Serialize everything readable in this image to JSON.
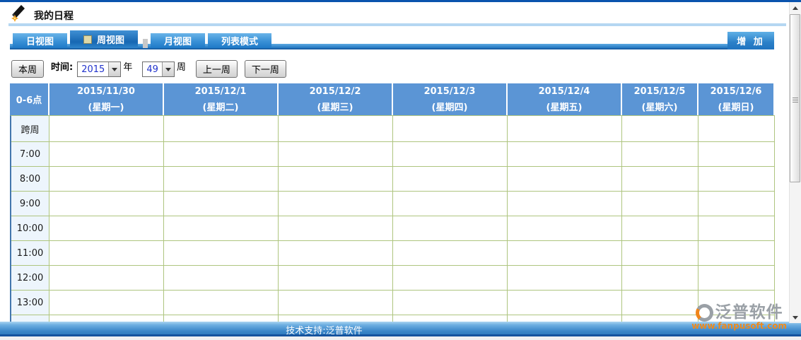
{
  "window": {
    "title": "我的日程"
  },
  "tabs": {
    "items": [
      {
        "label": "日视图",
        "active": false
      },
      {
        "label": "周视图",
        "active": true
      },
      {
        "label": "月视图",
        "active": false
      },
      {
        "label": "列表模式",
        "active": false
      }
    ],
    "add_button": "增 加"
  },
  "controls": {
    "this_week": "本周",
    "time_label": "时间:",
    "year": {
      "value": "2015",
      "suffix": "年"
    },
    "week": {
      "value": "49",
      "suffix": "周"
    },
    "prev_week": "上一周",
    "next_week": "下一周"
  },
  "calendar": {
    "corner": "0-6点",
    "days": [
      {
        "date": "2015/11/30",
        "weekday": "(星期一)"
      },
      {
        "date": "2015/12/1",
        "weekday": "(星期二)"
      },
      {
        "date": "2015/12/2",
        "weekday": "(星期三)"
      },
      {
        "date": "2015/12/3",
        "weekday": "(星期四)"
      },
      {
        "date": "2015/12/4",
        "weekday": "(星期五)"
      },
      {
        "date": "2015/12/5",
        "weekday": "(星期六)"
      },
      {
        "date": "2015/12/6",
        "weekday": "(星期日)"
      }
    ],
    "time_rows": [
      "跨周",
      "7:00",
      "8:00",
      "9:00",
      "10:00",
      "11:00",
      "12:00",
      "13:00"
    ]
  },
  "footer": {
    "support_text": "技术支持:泛普软件"
  },
  "watermark": {
    "brand": "泛普软件",
    "url": "www.fanpusoft.com"
  },
  "colors": {
    "header_blue": "#5b95d5",
    "grid_border": "#aec57f",
    "time_column_bg": "#edf5fc",
    "accent_blue": "#2277c4",
    "combo_text_blue": "#2233cc",
    "watermark_orange": "#ef8a1c"
  }
}
